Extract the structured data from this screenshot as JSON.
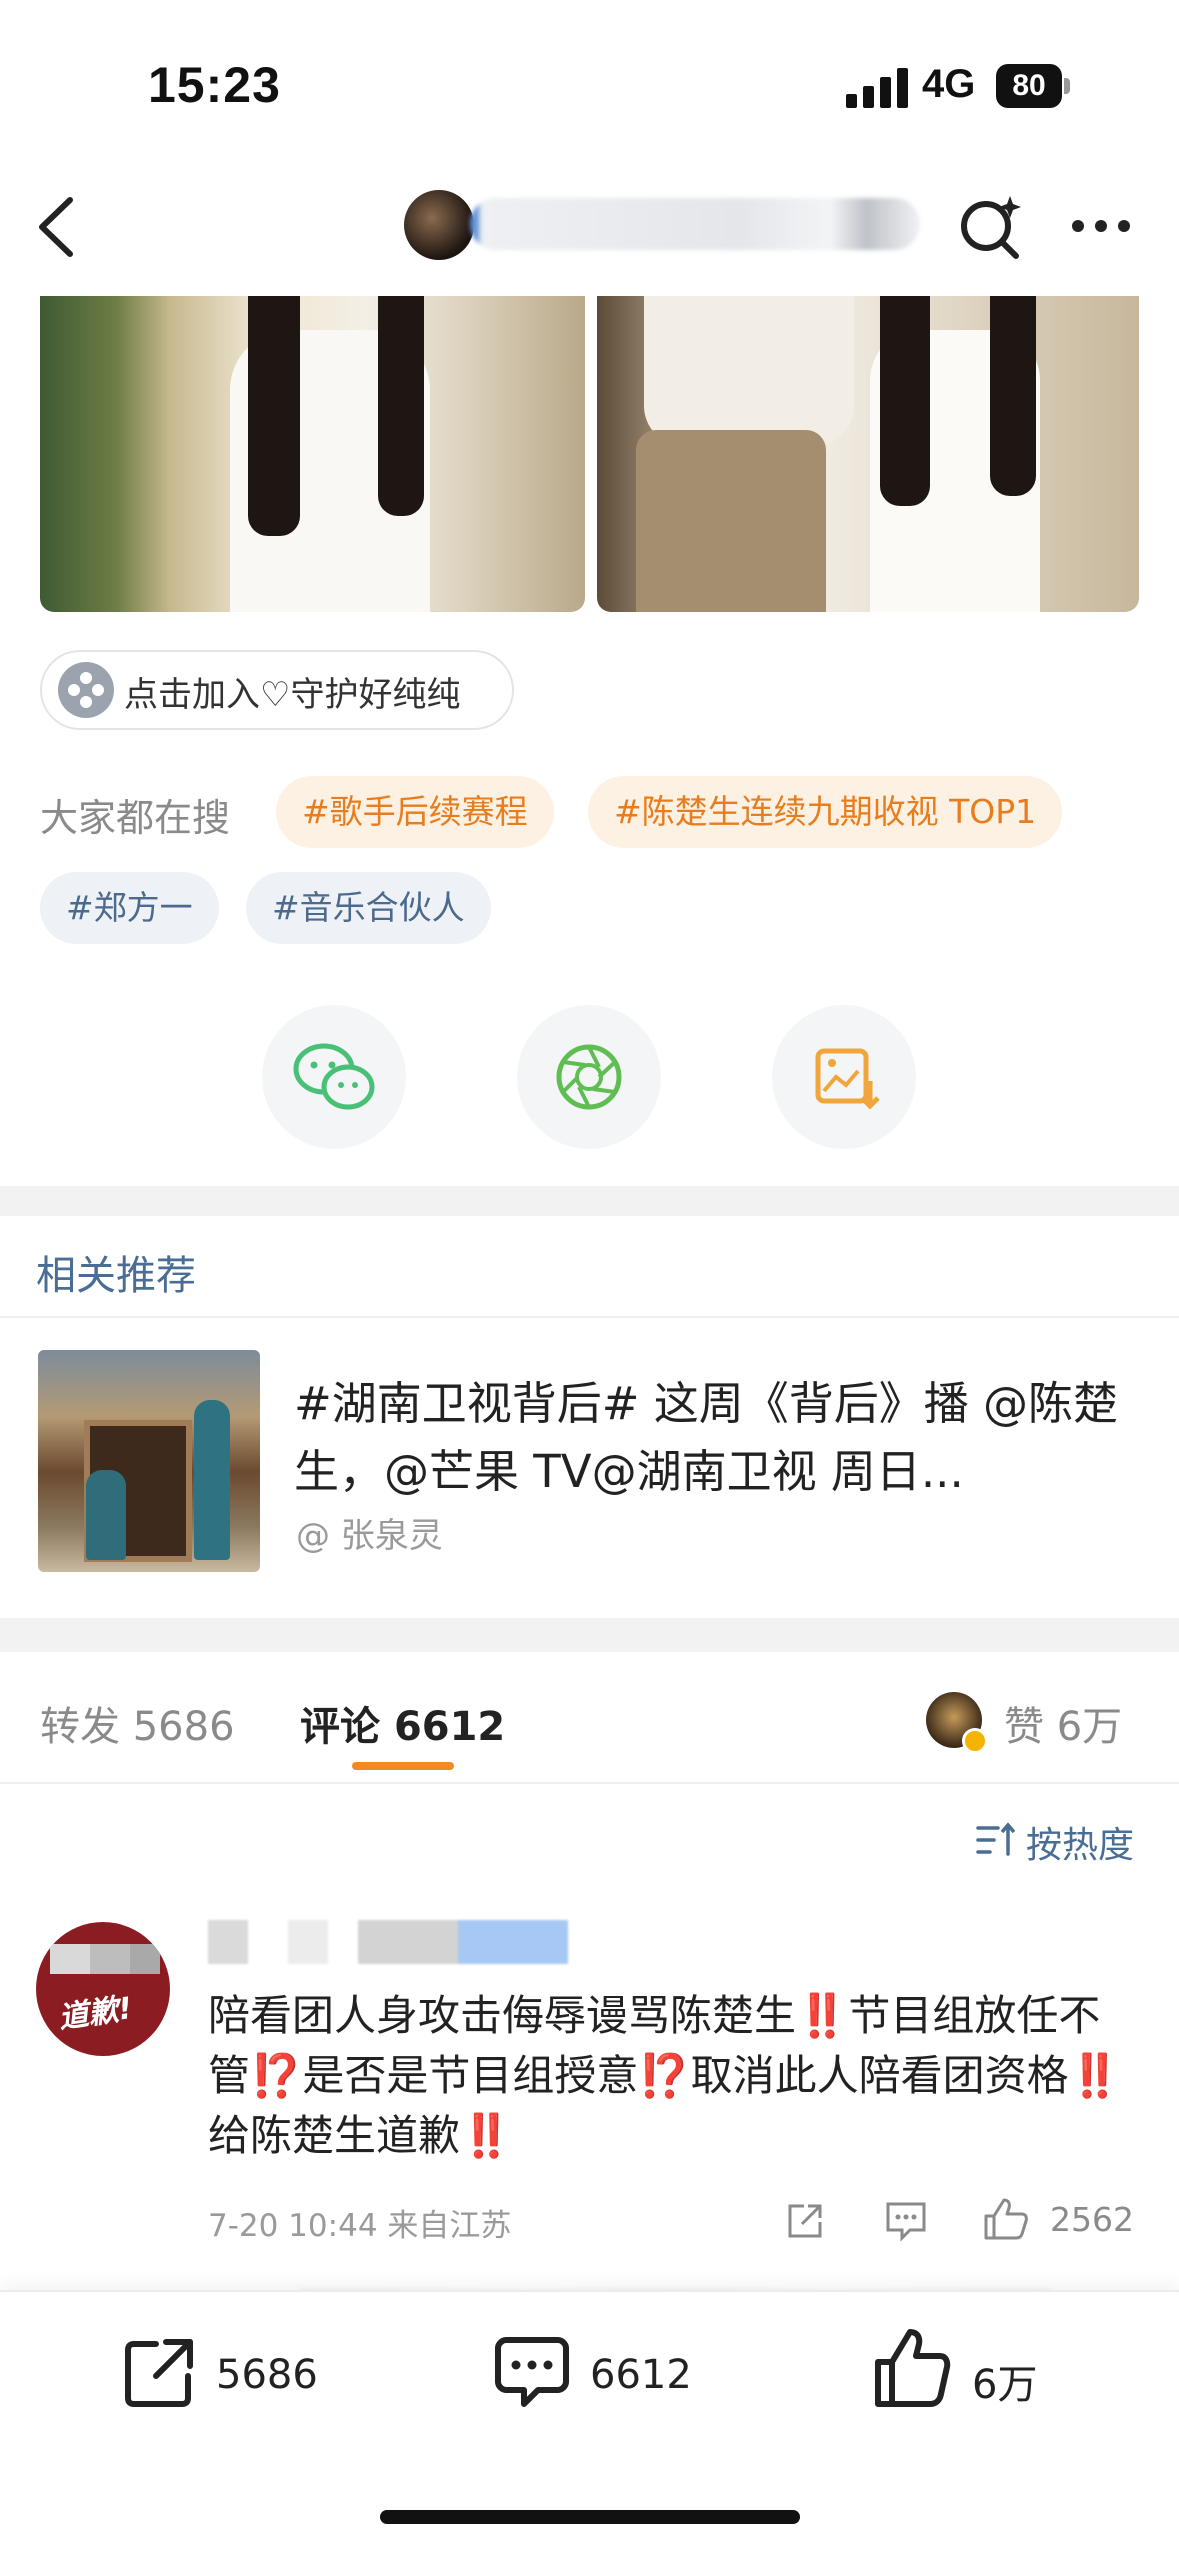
{
  "status_bar": {
    "time": "15:23",
    "network": "4G",
    "battery": "80"
  },
  "nav": {
    "back_icon": "chevron-left-icon",
    "search_icon": "search-sparkle-icon",
    "more_icon": "more-dots-icon"
  },
  "join": {
    "label": "点击加入♡守护好纯纯"
  },
  "searches": {
    "label": "大家都在搜",
    "tags": [
      "#歌手后续赛程",
      "#陈楚生连续九期收视 TOP1",
      "#郑方一",
      "#音乐合伙人"
    ]
  },
  "share_icons": [
    "wechat-icon",
    "moments-icon",
    "save-image-icon"
  ],
  "colors": {
    "accent_orange": "#f08a24",
    "link_blue": "#4a6d93",
    "tag_orange_bg": "#fdf1e3",
    "wechat_green": "#48c077",
    "alert_red": "#d61f26"
  },
  "related": {
    "heading": "相关推荐",
    "item": {
      "text": "#湖南卫视背后# 这周《背后》播 @陈楚生，@芒果 TV@湖南卫视 周日...",
      "author": "@ 张泉灵"
    }
  },
  "tabs": {
    "repost_label": "转发",
    "repost_count": "5686",
    "comment_label": "评论",
    "comment_count": "6612",
    "like_label": "赞",
    "like_count": "6万"
  },
  "sort": {
    "label": "按热度"
  },
  "comment": {
    "avatar_text": "道歉!",
    "text_parts": [
      "陪看团人身攻击侮辱谩骂陈楚生",
      "‼️",
      "节目组放任不管",
      "⁉️",
      "是否是节目组授意",
      "⁉️",
      "取消此人陪看团资格",
      "‼️",
      "给陈楚生道歉",
      "‼️"
    ],
    "time": "7-20 10:44",
    "location": "来自江苏",
    "like_count": "2562"
  },
  "bottom_bar": {
    "repost": "5686",
    "comment": "6612",
    "like": "6万"
  }
}
